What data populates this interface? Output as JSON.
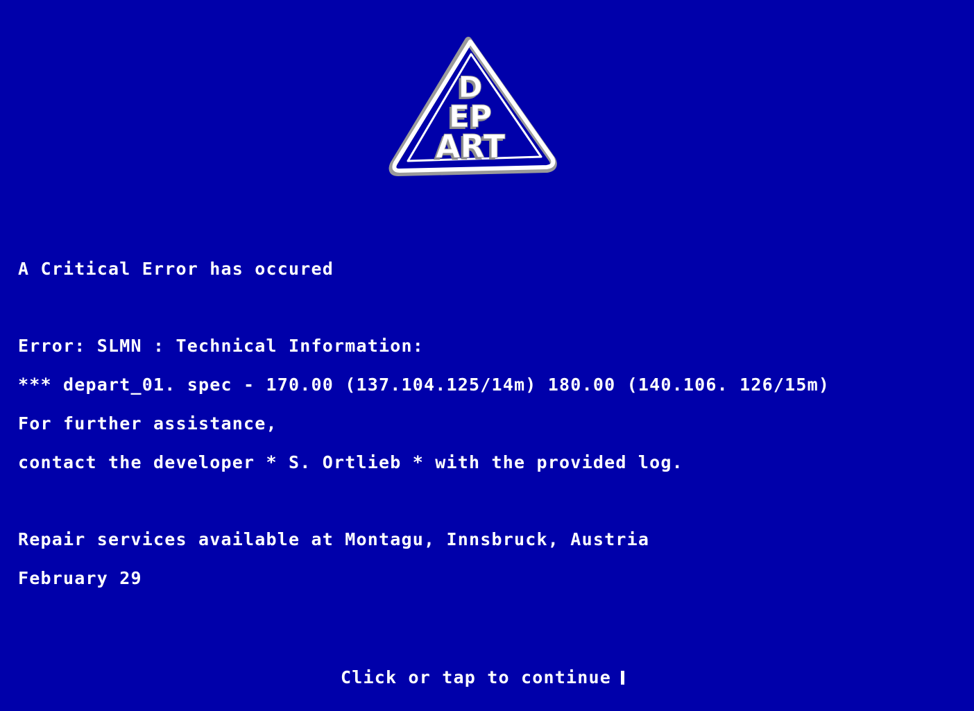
{
  "screen": {
    "background_color": "#0000AA",
    "text_color": "#FFFFFF",
    "logo": {
      "icon": "depart-triangle-logo",
      "text": [
        "D",
        "EP",
        "ART"
      ]
    },
    "lines": {
      "critical": "A Critical Error has occured",
      "error_header": "Error: SLMN : Technical Information:",
      "spec": "*** depart_01. spec - 170.00 (137.104.125/14m) 180.00 (140.106. 126/15m)",
      "assistance": "For further assistance,",
      "contact": "contact the developer * S. Ortlieb * with the provided log.",
      "repair": "Repair services available at Montagu, Innsbruck, Austria",
      "date": "February 29"
    },
    "continue_prompt": "Click or tap to continue"
  }
}
